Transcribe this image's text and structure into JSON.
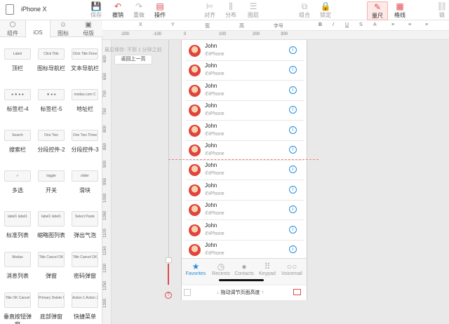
{
  "app": {
    "device_name": "iPhone X"
  },
  "toolbar": {
    "items": [
      {
        "label": "保存",
        "icon": "save-icon"
      },
      {
        "label": "撤销",
        "icon": "undo-icon"
      },
      {
        "label": "重做",
        "icon": "redo-icon"
      },
      {
        "label": "操作",
        "icon": "operation-icon"
      },
      {
        "label": "对齐",
        "icon": "align-icon"
      },
      {
        "label": "分布",
        "icon": "distribute-icon"
      },
      {
        "label": "图层",
        "icon": "layer-icon"
      },
      {
        "label": "组合",
        "icon": "group-icon"
      },
      {
        "label": "锁定",
        "icon": "lock-icon"
      },
      {
        "label": "量尺",
        "icon": "ruler-icon"
      },
      {
        "label": "格线",
        "icon": "grid-icon"
      },
      {
        "label": "链",
        "icon": "link-icon"
      }
    ]
  },
  "left_panel": {
    "tabs": [
      {
        "label": "组件",
        "icon": "component-icon"
      },
      {
        "label": "iOS",
        "icon": "apple-icon"
      },
      {
        "label": "图标",
        "icon": "emoji-icon"
      },
      {
        "label": "母版",
        "icon": "master-icon"
      }
    ],
    "components": [
      {
        "label": "顶栏",
        "thumb": "Label"
      },
      {
        "label": "图标导航栏",
        "thumb": "Click Title"
      },
      {
        "label": "文本导航栏",
        "thumb": "Click Title Done"
      },
      {
        "label": "标签栏-4",
        "thumb": "● ★ ● ●"
      },
      {
        "label": "标签栏-5",
        "thumb": "★ ● ●"
      },
      {
        "label": "地址栏",
        "thumb": "modao.com C"
      },
      {
        "label": "搜索栏",
        "thumb": "Search"
      },
      {
        "label": "分段控件-2",
        "thumb": "One Two"
      },
      {
        "label": "分段控件-3",
        "thumb": "One Two Three"
      },
      {
        "label": "多选",
        "thumb": "✓"
      },
      {
        "label": "开关",
        "thumb": "toggle"
      },
      {
        "label": "滑块",
        "thumb": "slider"
      },
      {
        "label": "标准列表",
        "thumb": "label1 label1"
      },
      {
        "label": "缩略图列表",
        "thumb": "label1 label1"
      },
      {
        "label": "弹出气泡",
        "thumb": "Select Paste"
      },
      {
        "label": "消息列表",
        "thumb": "Modao"
      },
      {
        "label": "弹窗",
        "thumb": "Title Cancel OK"
      },
      {
        "label": "密码弹窗",
        "thumb": "Title Cancel OK"
      },
      {
        "label": "垂直按钮弹窗",
        "thumb": "Title OK Cancel"
      },
      {
        "label": "底部弹窗",
        "thumb": "Primary Delete Cancel"
      },
      {
        "label": "快捷菜单",
        "thumb": "Action 1 Action 2 Action 3"
      }
    ]
  },
  "property_bar": {
    "fields": [
      "X",
      "Y",
      "宽",
      "高",
      "字号"
    ]
  },
  "rulers": {
    "top": [
      "-200",
      "-100",
      "0",
      "100",
      "200",
      "300"
    ],
    "left": [
      "600",
      "650",
      "700",
      "750",
      "800",
      "850",
      "900",
      "950",
      "1000",
      "1050",
      "1100",
      "1150",
      "1200",
      "1250",
      "1300"
    ]
  },
  "canvas": {
    "save_note": "最后保存: 不到 1 分钟之前",
    "back_button": "返回上一页"
  },
  "phone": {
    "contacts": [
      {
        "name": "John",
        "subtitle": "iPhone"
      },
      {
        "name": "John",
        "subtitle": "iPhone"
      },
      {
        "name": "John",
        "subtitle": "iPhone"
      },
      {
        "name": "John",
        "subtitle": "iPhone"
      },
      {
        "name": "John",
        "subtitle": "iPhone"
      },
      {
        "name": "John",
        "subtitle": "iPhone"
      },
      {
        "name": "John",
        "subtitle": "iPhone"
      },
      {
        "name": "John",
        "subtitle": "iPhone"
      },
      {
        "name": "John",
        "subtitle": "iPhone"
      },
      {
        "name": "John",
        "subtitle": "iPhone"
      },
      {
        "name": "John",
        "subtitle": "iPhone"
      }
    ],
    "tabbar": [
      {
        "label": "Favorites",
        "icon": "star-icon",
        "active": true
      },
      {
        "label": "Recents",
        "icon": "clock-icon",
        "active": false
      },
      {
        "label": "Contacts",
        "icon": "person-icon",
        "active": false
      },
      {
        "label": "Keypad",
        "icon": "keypad-icon",
        "active": false
      },
      {
        "label": "Voicemail",
        "icon": "voicemail-icon",
        "active": false
      }
    ],
    "resize_label": "拖动调节页面高度"
  },
  "colors": {
    "accent": "#e04b4b",
    "ios_blue": "#2a8fd6"
  }
}
